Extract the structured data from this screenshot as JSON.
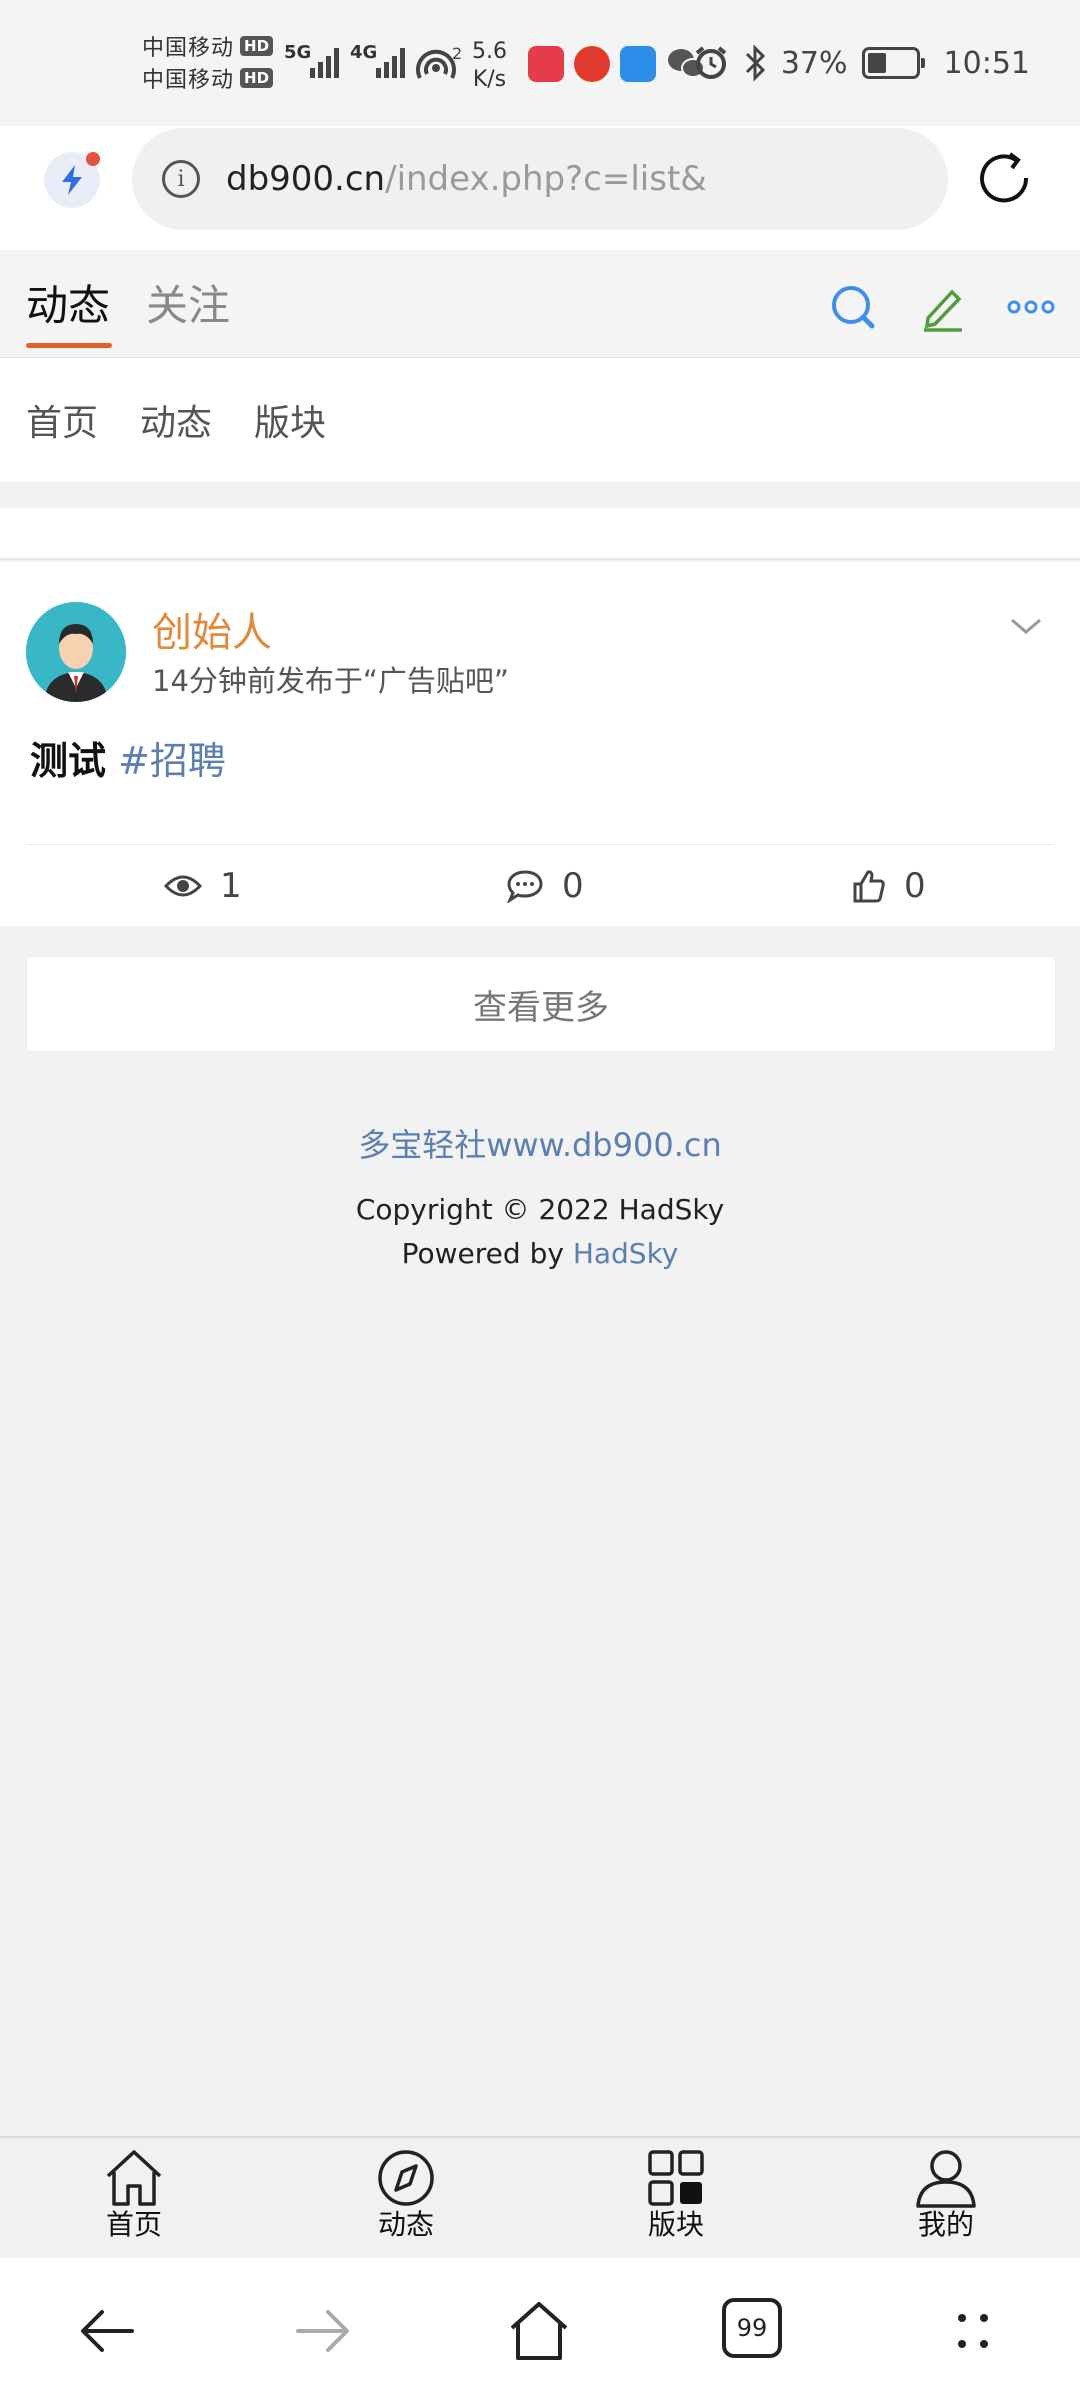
{
  "status_bar": {
    "carrier_line1": "中国移动",
    "carrier_line2": "中国移动",
    "hd_badge": "HD",
    "net1": "5G",
    "net2": "4G",
    "hotspot_count": "2",
    "speed_value": "5.6",
    "speed_unit": "K/s",
    "battery_percent": "37%",
    "time": "10:51"
  },
  "browser": {
    "url_host": "db900.cn",
    "url_path": "/index.php?c=list&"
  },
  "header": {
    "tab_active": "动态",
    "tab_follow": "关注",
    "accent_color": "#e0622d"
  },
  "subnav": {
    "items": [
      "首页",
      "动态",
      "版块"
    ]
  },
  "post": {
    "author": "创始人",
    "meta": "14分钟前发布于“广告贴吧”",
    "text": "测试",
    "tag": "#招聘",
    "views": "1",
    "comments": "0",
    "likes": "0"
  },
  "more_button": "查看更多",
  "footer": {
    "site": "多宝轻社www.db900.cn",
    "copyright": "Copyright © 2022 HadSky",
    "powered_prefix": "Powered by ",
    "powered_link": "HadSky"
  },
  "tabbar": {
    "items": [
      {
        "label": "首页",
        "icon": "home-icon"
      },
      {
        "label": "动态",
        "icon": "compass-icon"
      },
      {
        "label": "版块",
        "icon": "grid-icon"
      },
      {
        "label": "我的",
        "icon": "user-icon"
      }
    ]
  },
  "system_nav": {
    "tab_count": "99"
  }
}
